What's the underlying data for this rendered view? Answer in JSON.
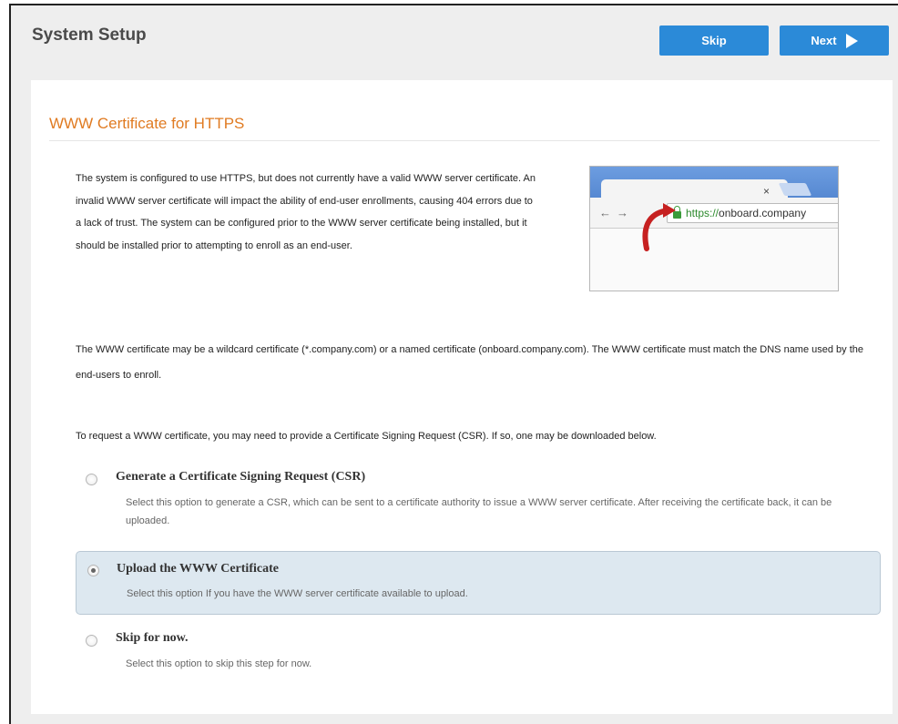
{
  "header": {
    "title": "System Setup",
    "skip_label": "Skip",
    "next_label": "Next"
  },
  "section": {
    "title": "WWW Certificate for HTTPS",
    "intro": "The system is configured to use HTTPS, but does not currently have a valid WWW server certificate. An invalid WWW server certificate will impact the ability of end-user enrollments, causing 404 errors due to a lack of trust. The system can be configured prior to the WWW server certificate being installed, but it should be installed prior to attempting to enroll as an end-user.",
    "paragraph2": "The WWW certificate may be a wildcard certificate (*.company.com) or a named certificate (onboard.company.com). The WWW certificate must match the DNS name used by the end-users to enroll.",
    "paragraph3": "To request a WWW certificate, you may need to provide a Certificate Signing Request (CSR). If so, one may be downloaded below."
  },
  "illustration": {
    "url_scheme": "https://",
    "url_host": "onboard.company",
    "tab_close": "×"
  },
  "options": [
    {
      "label": "Generate a Certificate Signing Request (CSR)",
      "description": "Select this option to generate a CSR, which can be sent to a certificate authority to issue a WWW server certificate. After receiving the certificate back, it can be uploaded.",
      "selected": false
    },
    {
      "label": "Upload the WWW Certificate",
      "description": "Select this option If you have the WWW server certificate available to upload.",
      "selected": true
    },
    {
      "label": "Skip for now.",
      "description": "Select this option to skip this step for now.",
      "selected": false
    }
  ],
  "colors": {
    "accent": "#2b8ad8",
    "section_title": "#e07b22",
    "selected_bg": "#dde8f0"
  }
}
